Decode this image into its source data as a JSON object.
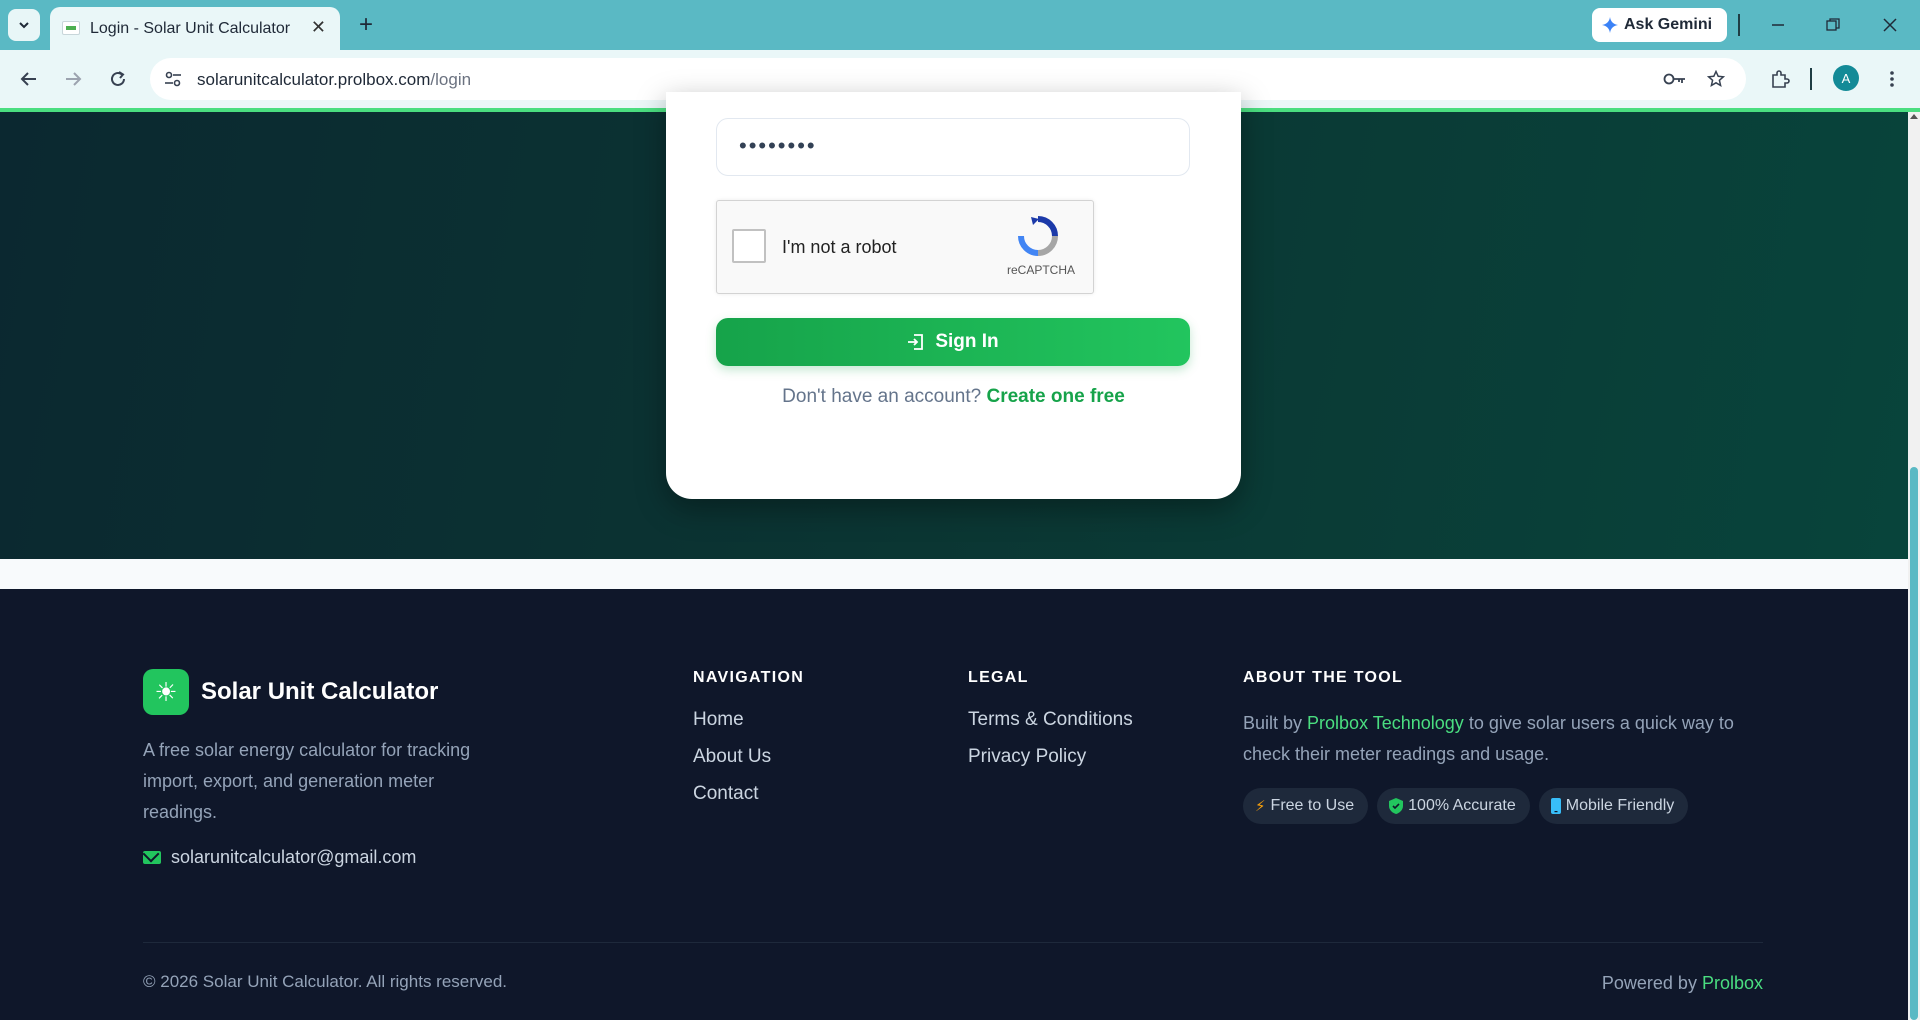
{
  "browser": {
    "tab_title": "Login - Solar Unit Calculator",
    "url_host": "solarunitcalculator.prolbox.com",
    "url_path": "/login",
    "gemini_label": "Ask Gemini",
    "profile_initial": "A",
    "accent": "#5ab9c4"
  },
  "login": {
    "password_value": "••••••••",
    "captcha_label": "I'm not a robot",
    "captcha_brand": "reCAPTCHA",
    "signin_label": "Sign In",
    "no_account_text": "Don't have an account?",
    "create_link": "Create one free"
  },
  "footer": {
    "brand_name": "Solar Unit Calculator",
    "brand_description": "A free solar energy calculator for tracking import, export, and generation meter readings.",
    "email": "solarunitcalculator@gmail.com",
    "navigation": {
      "title": "NAVIGATION",
      "links": [
        "Home",
        "About Us",
        "Contact"
      ]
    },
    "legal": {
      "title": "LEGAL",
      "links": [
        "Terms & Conditions",
        "Privacy Policy"
      ]
    },
    "about": {
      "title": "ABOUT THE TOOL",
      "text_before": "Built by ",
      "highlight": "Prolbox Technology",
      "text_after": " to give solar users a quick way to check their meter readings and usage.",
      "badges": [
        {
          "label": "Free to Use",
          "icon": "bolt-icon",
          "color": "#f59e0b"
        },
        {
          "label": "100% Accurate",
          "icon": "shield-icon",
          "color": "#22c55e"
        },
        {
          "label": "Mobile Friendly",
          "icon": "mobile-icon",
          "color": "#38bdf8"
        }
      ]
    },
    "copyright": "© 2026 Solar Unit Calculator. All rights reserved.",
    "powered_by_text": "Powered by",
    "powered_by_link": "Prolbox",
    "accent": "#22c55e"
  }
}
